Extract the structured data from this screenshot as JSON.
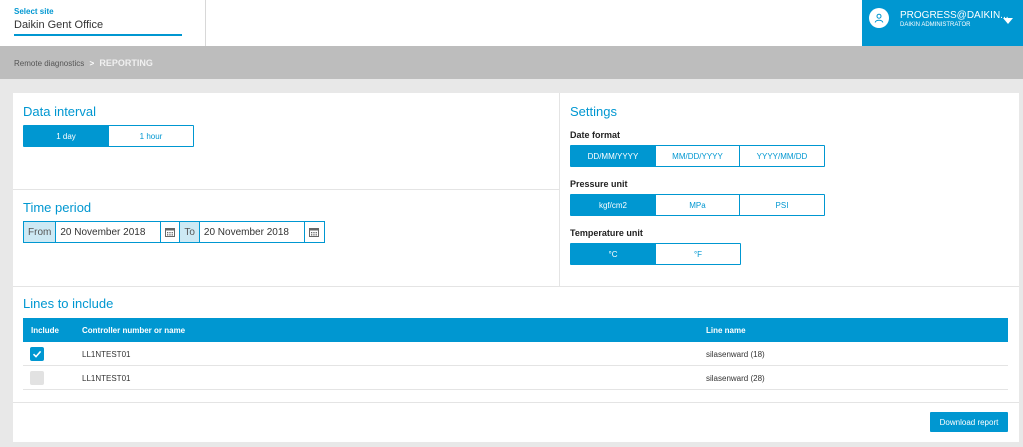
{
  "header": {
    "site_label": "Select site",
    "site_value": "Daikin Gent Office",
    "user_name": "PROGRESS@DAIKIN...",
    "user_role": "DAIKIN ADMINISTRATOR",
    "avatar_icon": "user-icon",
    "menu_icon": "caret-down-icon"
  },
  "breadcrumb": {
    "parent": "Remote diagnostics",
    "separator": ">",
    "current": "REPORTING"
  },
  "data_interval": {
    "title": "Data interval",
    "options": [
      "1 day",
      "1 hour"
    ],
    "selected": "1 day"
  },
  "time_period": {
    "title": "Time period",
    "from_label": "From",
    "from_value": "20 November 2018",
    "to_label": "To",
    "to_value": "20 November 2018",
    "calendar_icon": "calendar-icon"
  },
  "settings": {
    "title": "Settings",
    "date_format": {
      "label": "Date format",
      "options": [
        "DD/MM/YYYY",
        "MM/DD/YYYY",
        "YYYY/MM/DD"
      ],
      "selected": "DD/MM/YYYY"
    },
    "pressure_unit": {
      "label": "Pressure unit",
      "options": [
        "kgf/cm2",
        "MPa",
        "PSI"
      ],
      "selected": "kgf/cm2"
    },
    "temperature_unit": {
      "label": "Temperature unit",
      "options": [
        "°C",
        "°F"
      ],
      "selected": "°C"
    }
  },
  "lines": {
    "title": "Lines to include",
    "columns": [
      "Include",
      "Controller number or name",
      "Line name"
    ],
    "rows": [
      {
        "checked": true,
        "controller": "LL1NTEST01",
        "line": "silasenward (18)"
      },
      {
        "checked": false,
        "controller": "LL1NTEST01",
        "line": "silasenward (28)"
      }
    ]
  },
  "download_label": "Download report",
  "colors": {
    "accent": "#0097d1",
    "breadcrumb_bg": "#bdbdbd",
    "page_bg": "#e8e8e8"
  }
}
